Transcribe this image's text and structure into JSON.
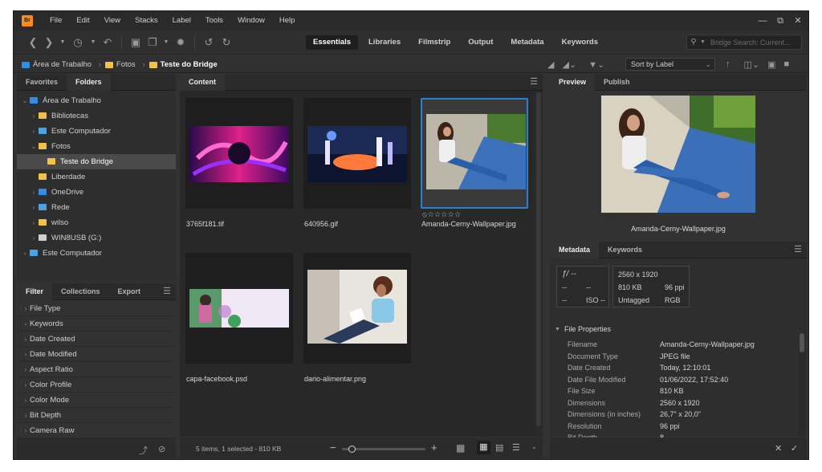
{
  "app": {
    "icon_label": "Br"
  },
  "menu": [
    "File",
    "Edit",
    "View",
    "Stacks",
    "Label",
    "Tools",
    "Window",
    "Help"
  ],
  "window_controls": [
    "minimize",
    "restore",
    "close"
  ],
  "workspaces": [
    {
      "label": "Essentials",
      "active": true
    },
    {
      "label": "Libraries",
      "active": false
    },
    {
      "label": "Filmstrip",
      "active": false
    },
    {
      "label": "Output",
      "active": false
    },
    {
      "label": "Metadata",
      "active": false
    },
    {
      "label": "Keywords",
      "active": false
    }
  ],
  "search": {
    "placeholder": "Bridge Search: Current..."
  },
  "breadcrumb": [
    {
      "label": "Área de Trabalho",
      "icon": "desktop-icon"
    },
    {
      "label": "Fotos",
      "icon": "folder-icon"
    },
    {
      "label": "Teste do Bridge",
      "icon": "folder-icon"
    }
  ],
  "sort": {
    "label": "Sort by Label"
  },
  "left_tabs": [
    {
      "label": "Favorites",
      "active": false
    },
    {
      "label": "Folders",
      "active": true
    }
  ],
  "folders": [
    {
      "label": "Área de Trabalho",
      "depth": 0,
      "expanded": true,
      "icon": "desktop-icon",
      "selected": false
    },
    {
      "label": "Bibliotecas",
      "depth": 1,
      "expanded": false,
      "icon": "libraries-icon",
      "selected": false
    },
    {
      "label": "Este Computador",
      "depth": 1,
      "expanded": false,
      "icon": "computer-icon",
      "selected": false
    },
    {
      "label": "Fotos",
      "depth": 1,
      "expanded": true,
      "icon": "folder-icon",
      "selected": false
    },
    {
      "label": "Teste do Bridge",
      "depth": 2,
      "expanded": null,
      "icon": "folder-icon",
      "selected": true
    },
    {
      "label": "Liberdade",
      "depth": 1,
      "expanded": null,
      "icon": "folder-icon",
      "selected": false
    },
    {
      "label": "OneDrive",
      "depth": 1,
      "expanded": false,
      "icon": "cloud-icon",
      "selected": false
    },
    {
      "label": "Rede",
      "depth": 1,
      "expanded": false,
      "icon": "network-icon",
      "selected": false
    },
    {
      "label": "wilso",
      "depth": 1,
      "expanded": false,
      "icon": "folder-icon",
      "selected": false
    },
    {
      "label": "WIN8USB (G:)",
      "depth": 1,
      "expanded": false,
      "icon": "drive-icon",
      "selected": false
    },
    {
      "label": "Este Computador",
      "depth": 0,
      "expanded": false,
      "icon": "computer-icon",
      "selected": false
    }
  ],
  "filter_tabs": [
    {
      "label": "Filter",
      "active": true
    },
    {
      "label": "Collections",
      "active": false
    },
    {
      "label": "Export",
      "active": false
    }
  ],
  "filters": [
    "File Type",
    "Keywords",
    "Date Created",
    "Date Modified",
    "Aspect Ratio",
    "Color Profile",
    "Color Mode",
    "Bit Depth",
    "Camera Raw"
  ],
  "content_tab": {
    "label": "Content"
  },
  "thumbnails": [
    {
      "name": "3765f181.tif",
      "selected": false,
      "rating": null,
      "art": "art-neon"
    },
    {
      "name": "640956.gif",
      "selected": false,
      "rating": null,
      "art": "art-anime"
    },
    {
      "name": "Amanda-Cerny-Wallpaper.jpg",
      "selected": true,
      "rating": "⦸☆☆☆☆☆",
      "art": "art-road"
    },
    {
      "name": "capa-facebook.psd",
      "selected": false,
      "rating": null,
      "art": "art-banner"
    },
    {
      "name": "dario-alimentar.png",
      "selected": false,
      "rating": null,
      "art": "art-reading"
    }
  ],
  "status": {
    "text": "5 items, 1 selected - 810 KB"
  },
  "preview_tabs": [
    {
      "label": "Preview",
      "active": true
    },
    {
      "label": "Publish",
      "active": false
    }
  ],
  "preview": {
    "caption": "Amanda-Cerny-Wallpaper.jpg"
  },
  "meta_tabs": [
    {
      "label": "Metadata",
      "active": true
    },
    {
      "label": "Keywords",
      "active": false
    }
  ],
  "camera_info": {
    "fstop": "ƒ/ --",
    "shutter": "--",
    "exposure_a": "--",
    "exposure_b": "--",
    "wb": "--",
    "iso": "ISO --"
  },
  "image_info": {
    "dimensions": "2560 x 1920",
    "size": "810 KB",
    "ppi": "96 ppi",
    "color_label": "Untagged",
    "mode": "RGB"
  },
  "file_properties": {
    "section_label": "File Properties",
    "rows": [
      {
        "k": "Filename",
        "v": "Amanda-Cerny-Wallpaper.jpg"
      },
      {
        "k": "Document Type",
        "v": "JPEG file"
      },
      {
        "k": "Date Created",
        "v": "Today, 12:10:01"
      },
      {
        "k": "Date File Modified",
        "v": "01/06/2022, 17:52:40"
      },
      {
        "k": "File Size",
        "v": "810 KB"
      },
      {
        "k": "Dimensions",
        "v": "2560 x 1920"
      },
      {
        "k": "Dimensions (in inches)",
        "v": "26,7\" x 20,0\""
      },
      {
        "k": "Resolution",
        "v": "96 ppi"
      },
      {
        "k": "Bit Depth",
        "v": "8"
      }
    ]
  },
  "zoom": {
    "level": 0.12
  }
}
